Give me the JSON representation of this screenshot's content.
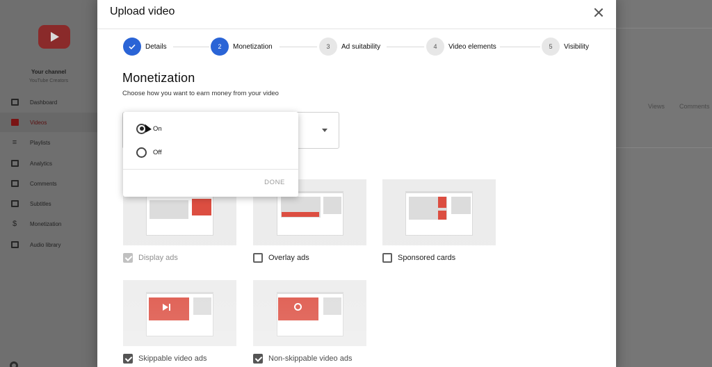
{
  "background": {
    "sidebar": {
      "channel_title": "Your channel",
      "channel_subtitle": "YouTube Creators",
      "items": [
        {
          "label": "Dashboard",
          "icon": "dashboard-icon",
          "active": false
        },
        {
          "label": "Videos",
          "icon": "videos-icon",
          "active": true
        },
        {
          "label": "Playlists",
          "icon": "playlists-icon",
          "active": false
        },
        {
          "label": "Analytics",
          "icon": "analytics-icon",
          "active": false
        },
        {
          "label": "Comments",
          "icon": "comments-icon",
          "active": false
        },
        {
          "label": "Subtitles",
          "icon": "subtitles-icon",
          "active": false
        },
        {
          "label": "Monetization",
          "icon": "dollar-icon",
          "active": false
        },
        {
          "label": "Audio library",
          "icon": "audio-library-icon",
          "active": false
        }
      ]
    },
    "table_columns": [
      "Views",
      "Comments"
    ]
  },
  "modal": {
    "title": "Upload video",
    "steps": [
      {
        "number": "",
        "label": "Details",
        "state": "complete"
      },
      {
        "number": "2",
        "label": "Monetization",
        "state": "active"
      },
      {
        "number": "3",
        "label": "Ad suitability",
        "state": "inactive"
      },
      {
        "number": "4",
        "label": "Video elements",
        "state": "inactive"
      },
      {
        "number": "5",
        "label": "Visibility",
        "state": "inactive"
      }
    ],
    "section_title": "Monetization",
    "section_description": "Choose how you want to earn money from your video",
    "monetization_dropdown": {
      "options": [
        "On",
        "Off"
      ],
      "selected": "On",
      "done_label": "DONE"
    },
    "ad_types": [
      {
        "label": "Display ads",
        "checked": true,
        "disabled": true
      },
      {
        "label": "Overlay ads",
        "checked": false,
        "disabled": false
      },
      {
        "label": "Sponsored cards",
        "checked": false,
        "disabled": false
      },
      {
        "label": "Skippable video ads",
        "checked": true,
        "disabled": false
      },
      {
        "label": "Non-skippable video ads",
        "checked": true,
        "disabled": false
      }
    ]
  },
  "colors": {
    "accent_blue": "#2a64d6",
    "ad_red": "#dc4e41"
  }
}
